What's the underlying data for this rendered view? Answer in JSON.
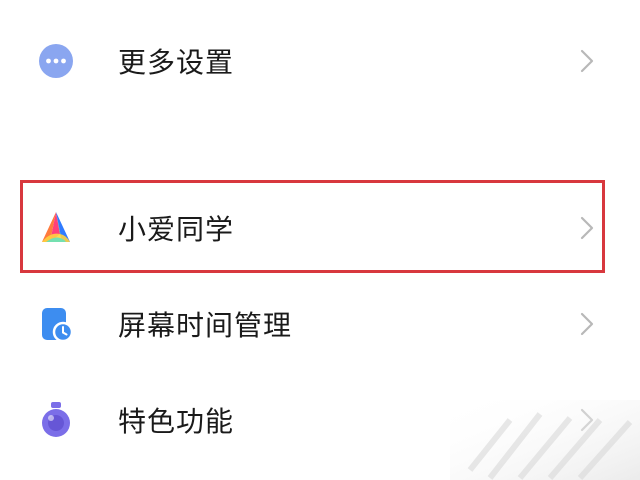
{
  "settings_list": {
    "items": [
      {
        "label": "更多设置",
        "icon": "more-dots-icon"
      },
      {
        "label": "小爱同学",
        "icon": "xiaoai-assistant-icon"
      },
      {
        "label": "屏幕时间管理",
        "icon": "screen-time-icon"
      },
      {
        "label": "特色功能",
        "icon": "special-features-icon"
      }
    ],
    "highlighted_item": "小爱同学"
  },
  "colors": {
    "highlight_border": "#d8383e",
    "text": "#1a1a1a",
    "chevron": "#b8b8b8",
    "more_icon": "#8aa6f0",
    "screen_time_icon": "#3d8df0",
    "features_icon": "#7b6ee8"
  }
}
